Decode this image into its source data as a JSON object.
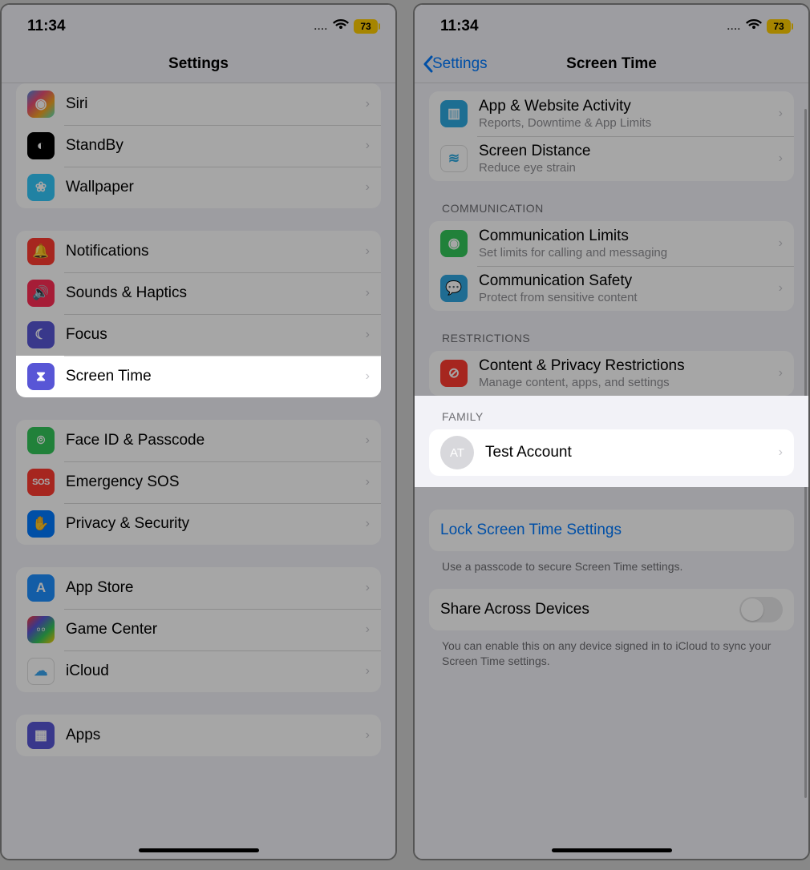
{
  "status": {
    "time": "11:34",
    "battery": "73",
    "dots": "...."
  },
  "left": {
    "title": "Settings",
    "groups": [
      {
        "rows": [
          {
            "icon": "siri-icon",
            "label": "Siri"
          },
          {
            "icon": "standby-icon",
            "label": "StandBy"
          },
          {
            "icon": "wallpaper-icon",
            "label": "Wallpaper"
          }
        ]
      },
      {
        "rows": [
          {
            "icon": "notifications-icon",
            "label": "Notifications"
          },
          {
            "icon": "sounds-icon",
            "label": "Sounds & Haptics"
          },
          {
            "icon": "focus-icon",
            "label": "Focus"
          },
          {
            "icon": "screentime-icon",
            "label": "Screen Time",
            "highlight": true
          }
        ]
      },
      {
        "rows": [
          {
            "icon": "faceid-icon",
            "label": "Face ID & Passcode"
          },
          {
            "icon": "sos-icon",
            "label": "Emergency SOS"
          },
          {
            "icon": "privacy-icon",
            "label": "Privacy & Security"
          }
        ]
      },
      {
        "rows": [
          {
            "icon": "appstore-icon",
            "label": "App Store"
          },
          {
            "icon": "gamecenter-icon",
            "label": "Game Center"
          },
          {
            "icon": "icloud-icon",
            "label": "iCloud"
          }
        ]
      },
      {
        "rows": [
          {
            "icon": "apps-icon",
            "label": "Apps"
          }
        ]
      }
    ]
  },
  "right": {
    "back": "Settings",
    "title": "Screen Time",
    "top_rows": [
      {
        "icon": "activity-icon",
        "label": "App & Website Activity",
        "sub": "Reports, Downtime & App Limits"
      },
      {
        "icon": "distance-icon",
        "label": "Screen Distance",
        "sub": "Reduce eye strain"
      }
    ],
    "comm_header": "COMMUNICATION",
    "comm_rows": [
      {
        "icon": "commlimits-icon",
        "label": "Communication Limits",
        "sub": "Set limits for calling and messaging"
      },
      {
        "icon": "commsafety-icon",
        "label": "Communication Safety",
        "sub": "Protect from sensitive content"
      }
    ],
    "restr_header": "RESTRICTIONS",
    "restr_rows": [
      {
        "icon": "content-icon",
        "label": "Content & Privacy Restrictions",
        "sub": "Manage content, apps, and settings"
      }
    ],
    "family_header": "FAMILY",
    "family": {
      "initials": "AT",
      "name": "Test Account"
    },
    "lock": {
      "label": "Lock Screen Time Settings",
      "footer": "Use a passcode to secure Screen Time settings."
    },
    "share": {
      "label": "Share Across Devices",
      "footer": "You can enable this on any device signed in to iCloud to sync your Screen Time settings."
    }
  }
}
